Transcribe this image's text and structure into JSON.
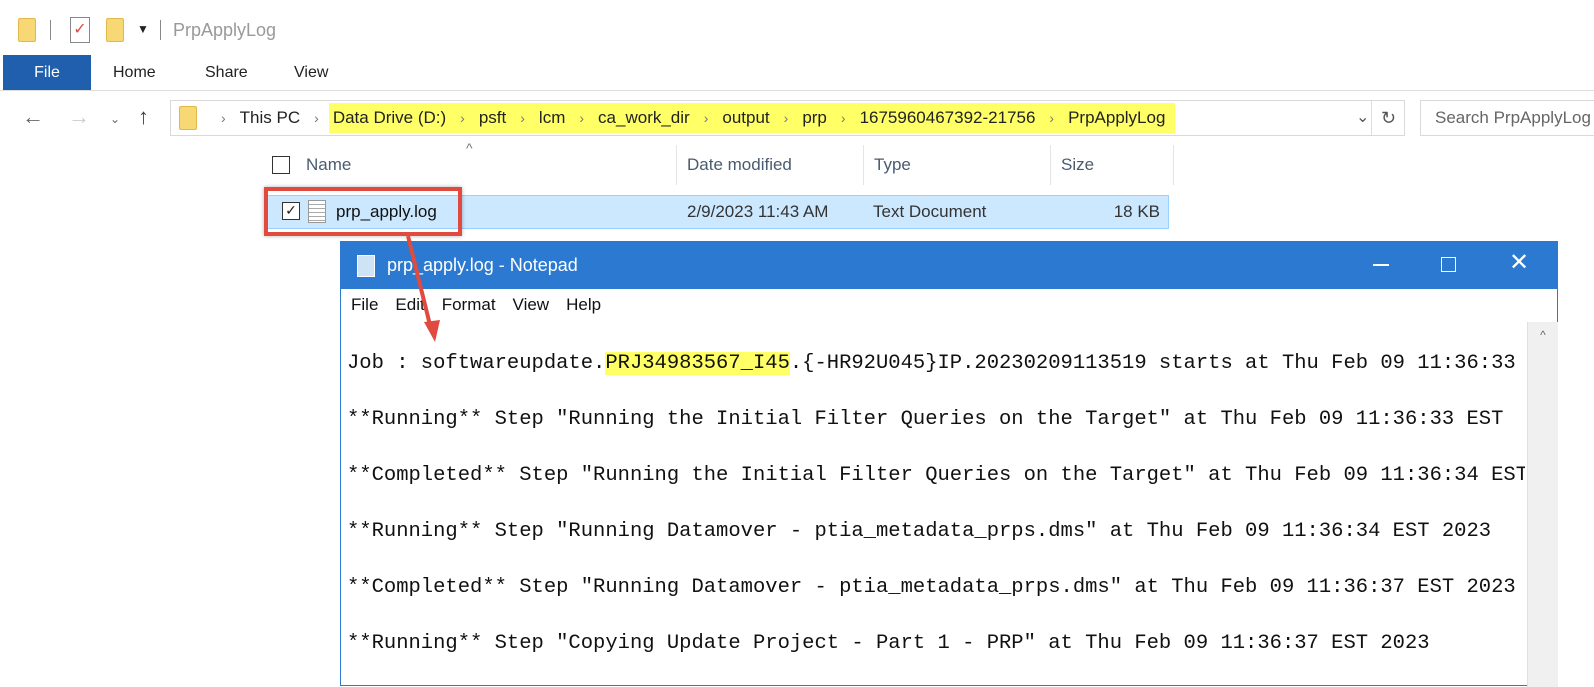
{
  "explorer": {
    "title": "PrpApplyLog",
    "ribbon_tabs": [
      "File",
      "Home",
      "Share",
      "View"
    ],
    "breadcrumb": [
      "This PC",
      "Data Drive (D:)",
      "psft",
      "lcm",
      "ca_work_dir",
      "output",
      "prp",
      "1675960467392-21756",
      "PrpApplyLog"
    ],
    "search_placeholder": "Search PrpApplyLog",
    "columns": {
      "name": "Name",
      "date": "Date modified",
      "type": "Type",
      "size": "Size"
    },
    "files": [
      {
        "name": "prp_apply.log",
        "date": "2/9/2023 11:43 AM",
        "type": "Text Document",
        "size": "18 KB"
      }
    ]
  },
  "notepad": {
    "title": "prp_apply.log - Notepad",
    "menu": [
      "File",
      "Edit",
      "Format",
      "View",
      "Help"
    ],
    "first_line": {
      "pre": "Job : softwareupdate.",
      "highlight": "PRJ34983567_I45",
      "post": ".{-HR92U045}IP.20230209113519 starts at Thu Feb 09 11:36:33"
    },
    "lines": [
      "**Running** Step \"Running the Initial Filter Queries on the Target\" at Thu Feb 09 11:36:33 EST",
      "**Completed** Step \"Running the Initial Filter Queries on the Target\" at Thu Feb 09 11:36:34 EST",
      "**Running** Step \"Running Datamover - ptia_metadata_prps.dms\" at Thu Feb 09 11:36:34 EST 2023",
      "**Completed** Step \"Running Datamover - ptia_metadata_prps.dms\" at Thu Feb 09 11:36:37 EST 2023",
      "**Running** Step \"Copying Update Project - Part 1 - PRP\" at Thu Feb 09 11:36:37 EST 2023"
    ]
  },
  "colors": {
    "highlight": "#ffff66",
    "annotation": "#e04a3f",
    "accent": "#2b79d0"
  }
}
